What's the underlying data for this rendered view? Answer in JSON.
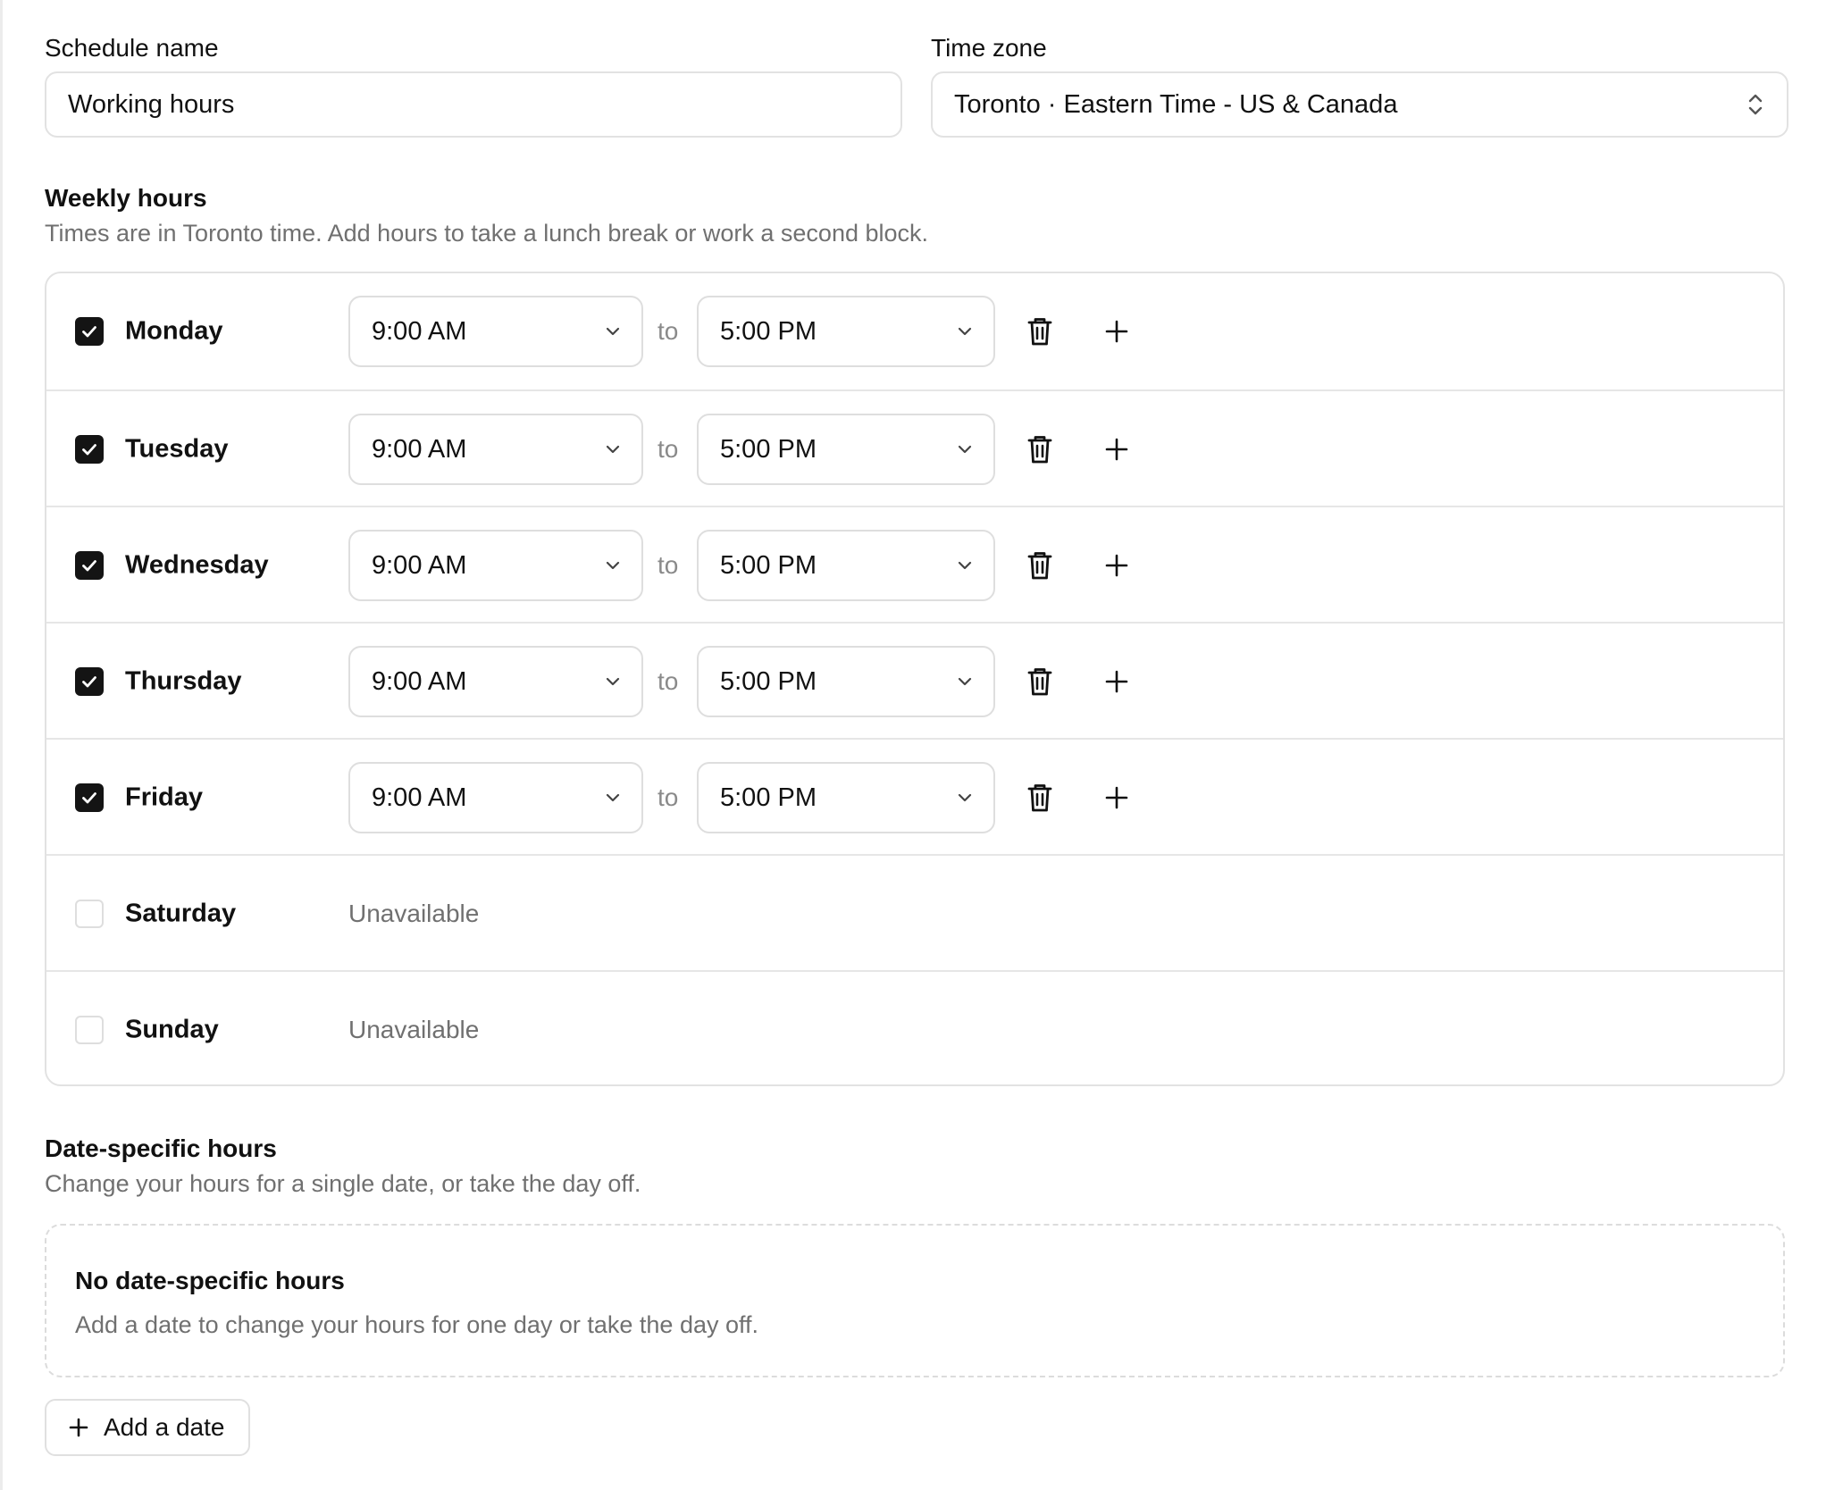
{
  "schedule": {
    "name_label": "Schedule name",
    "name_value": "Working hours",
    "timezone_label": "Time zone",
    "timezone_value": "Toronto · Eastern Time - US & Canada"
  },
  "weekly": {
    "title": "Weekly hours",
    "description": "Times are in Toronto time. Add hours to take a lunch break or work a second block.",
    "to_word": "to",
    "unavailable_text": "Unavailable",
    "days": [
      {
        "name": "Monday",
        "enabled": true,
        "from": "9:00 AM",
        "to": "5:00 PM"
      },
      {
        "name": "Tuesday",
        "enabled": true,
        "from": "9:00 AM",
        "to": "5:00 PM"
      },
      {
        "name": "Wednesday",
        "enabled": true,
        "from": "9:00 AM",
        "to": "5:00 PM"
      },
      {
        "name": "Thursday",
        "enabled": true,
        "from": "9:00 AM",
        "to": "5:00 PM"
      },
      {
        "name": "Friday",
        "enabled": true,
        "from": "9:00 AM",
        "to": "5:00 PM"
      },
      {
        "name": "Saturday",
        "enabled": false
      },
      {
        "name": "Sunday",
        "enabled": false
      }
    ]
  },
  "date_specific": {
    "title": "Date-specific hours",
    "description": "Change your hours for a single date, or take the day off.",
    "empty_title": "No date-specific hours",
    "empty_description": "Add a date to change your hours for one day or take the day off.",
    "add_button_label": "Add a date"
  },
  "icons": {
    "checkbox": "check-icon",
    "select": "chevron-down-icon",
    "timezone_select": "chevron-up-down-icon",
    "delete": "trash-icon",
    "add": "plus-icon"
  }
}
